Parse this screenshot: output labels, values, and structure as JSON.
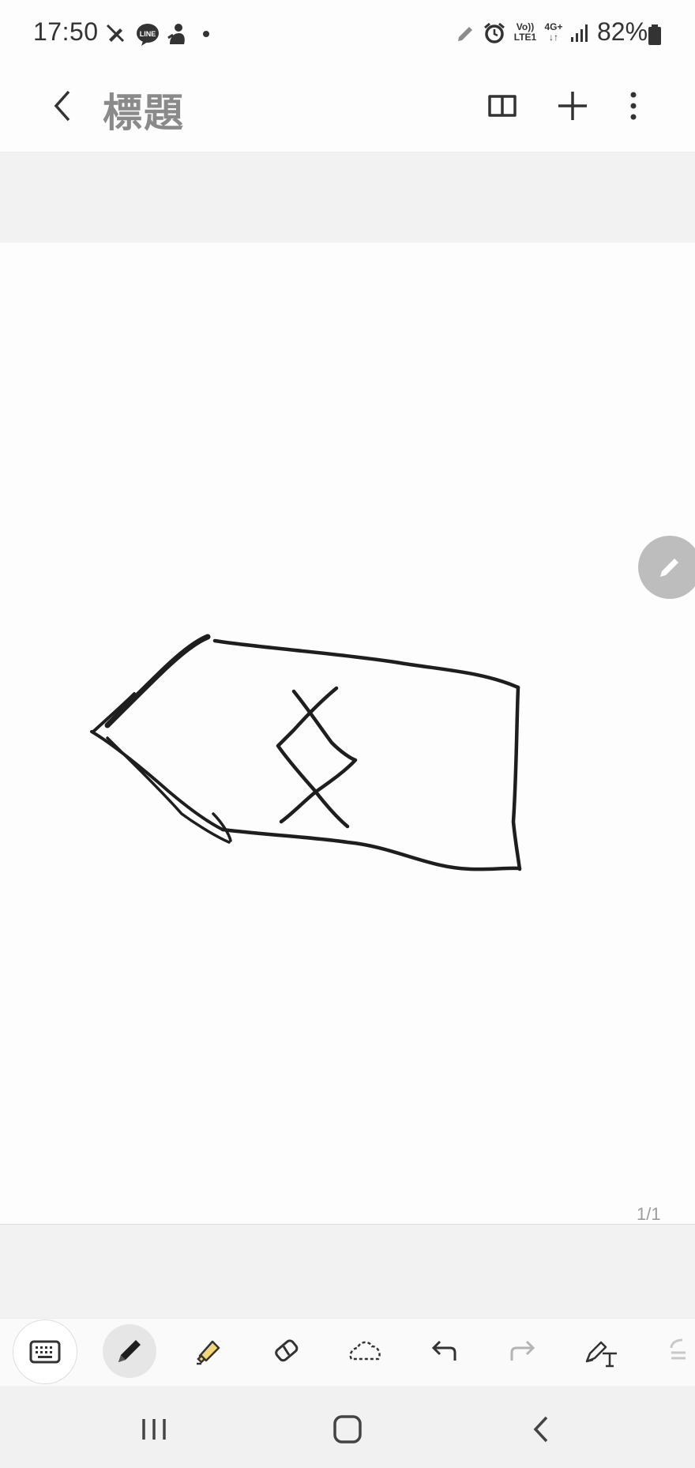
{
  "status_bar": {
    "time": "17:50",
    "network_top": "Vo))",
    "network_bottom": "LTE1",
    "data_top": "4G+",
    "data_bottom": "↓↑",
    "battery": "82%",
    "left_icons": [
      "pen-off-icon",
      "line-app-icon",
      "notification-icon",
      "dot-icon"
    ],
    "right_icons": [
      "pen-icon",
      "alarm-icon",
      "volte-icon",
      "data-icon",
      "signal-icon",
      "battery-icon"
    ]
  },
  "header": {
    "title": "標題",
    "actions": [
      "book-view-icon",
      "add-page-icon",
      "more-options-icon"
    ]
  },
  "canvas": {
    "page_indicator": "1/1",
    "drawing": "handwritten-sketch"
  },
  "toolbar": {
    "tools": [
      {
        "name": "keyboard",
        "selected": false
      },
      {
        "name": "pen",
        "selected": true
      },
      {
        "name": "highlighter",
        "selected": false
      },
      {
        "name": "eraser",
        "selected": false
      },
      {
        "name": "lasso",
        "selected": false
      },
      {
        "name": "undo",
        "selected": false
      },
      {
        "name": "redo",
        "selected": false,
        "disabled": true
      },
      {
        "name": "handwriting-to-text",
        "selected": false
      },
      {
        "name": "more-tools",
        "selected": false
      }
    ],
    "accent_highlighter": "#f4d57a"
  },
  "nav_bar": {
    "buttons": [
      "recent-apps",
      "home",
      "back"
    ]
  }
}
